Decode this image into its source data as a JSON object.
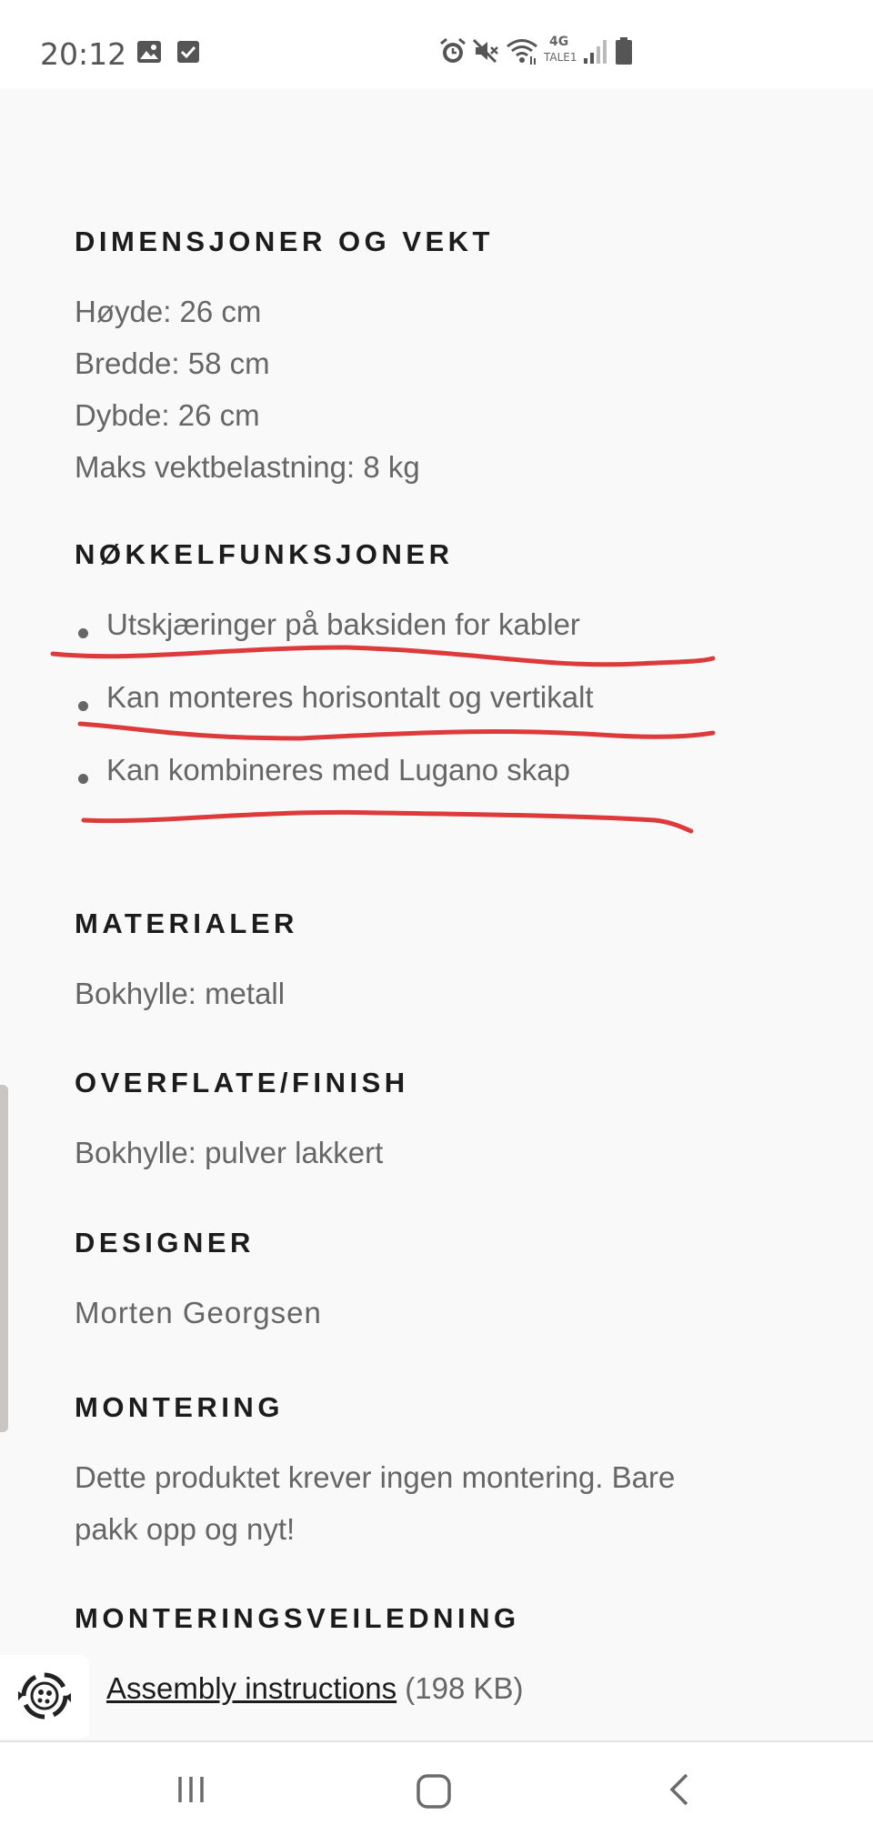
{
  "status_bar": {
    "time": "20:12",
    "left_icons": [
      "gallery-icon",
      "check-box-icon"
    ],
    "right_icons": [
      "alarm-icon",
      "mute-icon",
      "wifi-icon",
      "signal-icon",
      "battery-icon"
    ],
    "network_type": "4G",
    "network_sub": "TALE1"
  },
  "sections": {
    "dimensions": {
      "heading": "DIMENSJONER OG VEKT",
      "lines": [
        "Høyde: 26 cm",
        "Bredde: 58 cm",
        "Dybde: 26 cm",
        "Maks vektbelastning: 8 kg"
      ]
    },
    "key_features": {
      "heading": "NØKKELFUNKSJONER",
      "items": [
        "Utskjæringer på baksiden for kabler",
        "Kan monteres horisontalt og vertikalt",
        "Kan kombineres med Lugano skap"
      ]
    },
    "materials": {
      "heading": "MATERIALER",
      "text": "Bokhylle: metall"
    },
    "finish": {
      "heading": "OVERFLATE/FINISH",
      "text": "Bokhylle: pulver lakkert"
    },
    "designer": {
      "heading": "DESIGNER",
      "text": "Morten Georgsen"
    },
    "assembly": {
      "heading": "MONTERING",
      "lines": [
        "Dette produktet krever ingen montering. Bare",
        "pakk opp og nyt!"
      ]
    },
    "assembly_guide": {
      "heading": "MONTERINGSVEILEDNING",
      "link_label": "Assembly instructions",
      "file_size": "(198 KB)"
    }
  },
  "annotation": {
    "color": "#dd3b3b"
  },
  "fab": {
    "icon": "accessibility-icon"
  },
  "nav_bar": {
    "buttons": [
      "recent-apps-icon",
      "home-icon",
      "back-icon"
    ]
  }
}
